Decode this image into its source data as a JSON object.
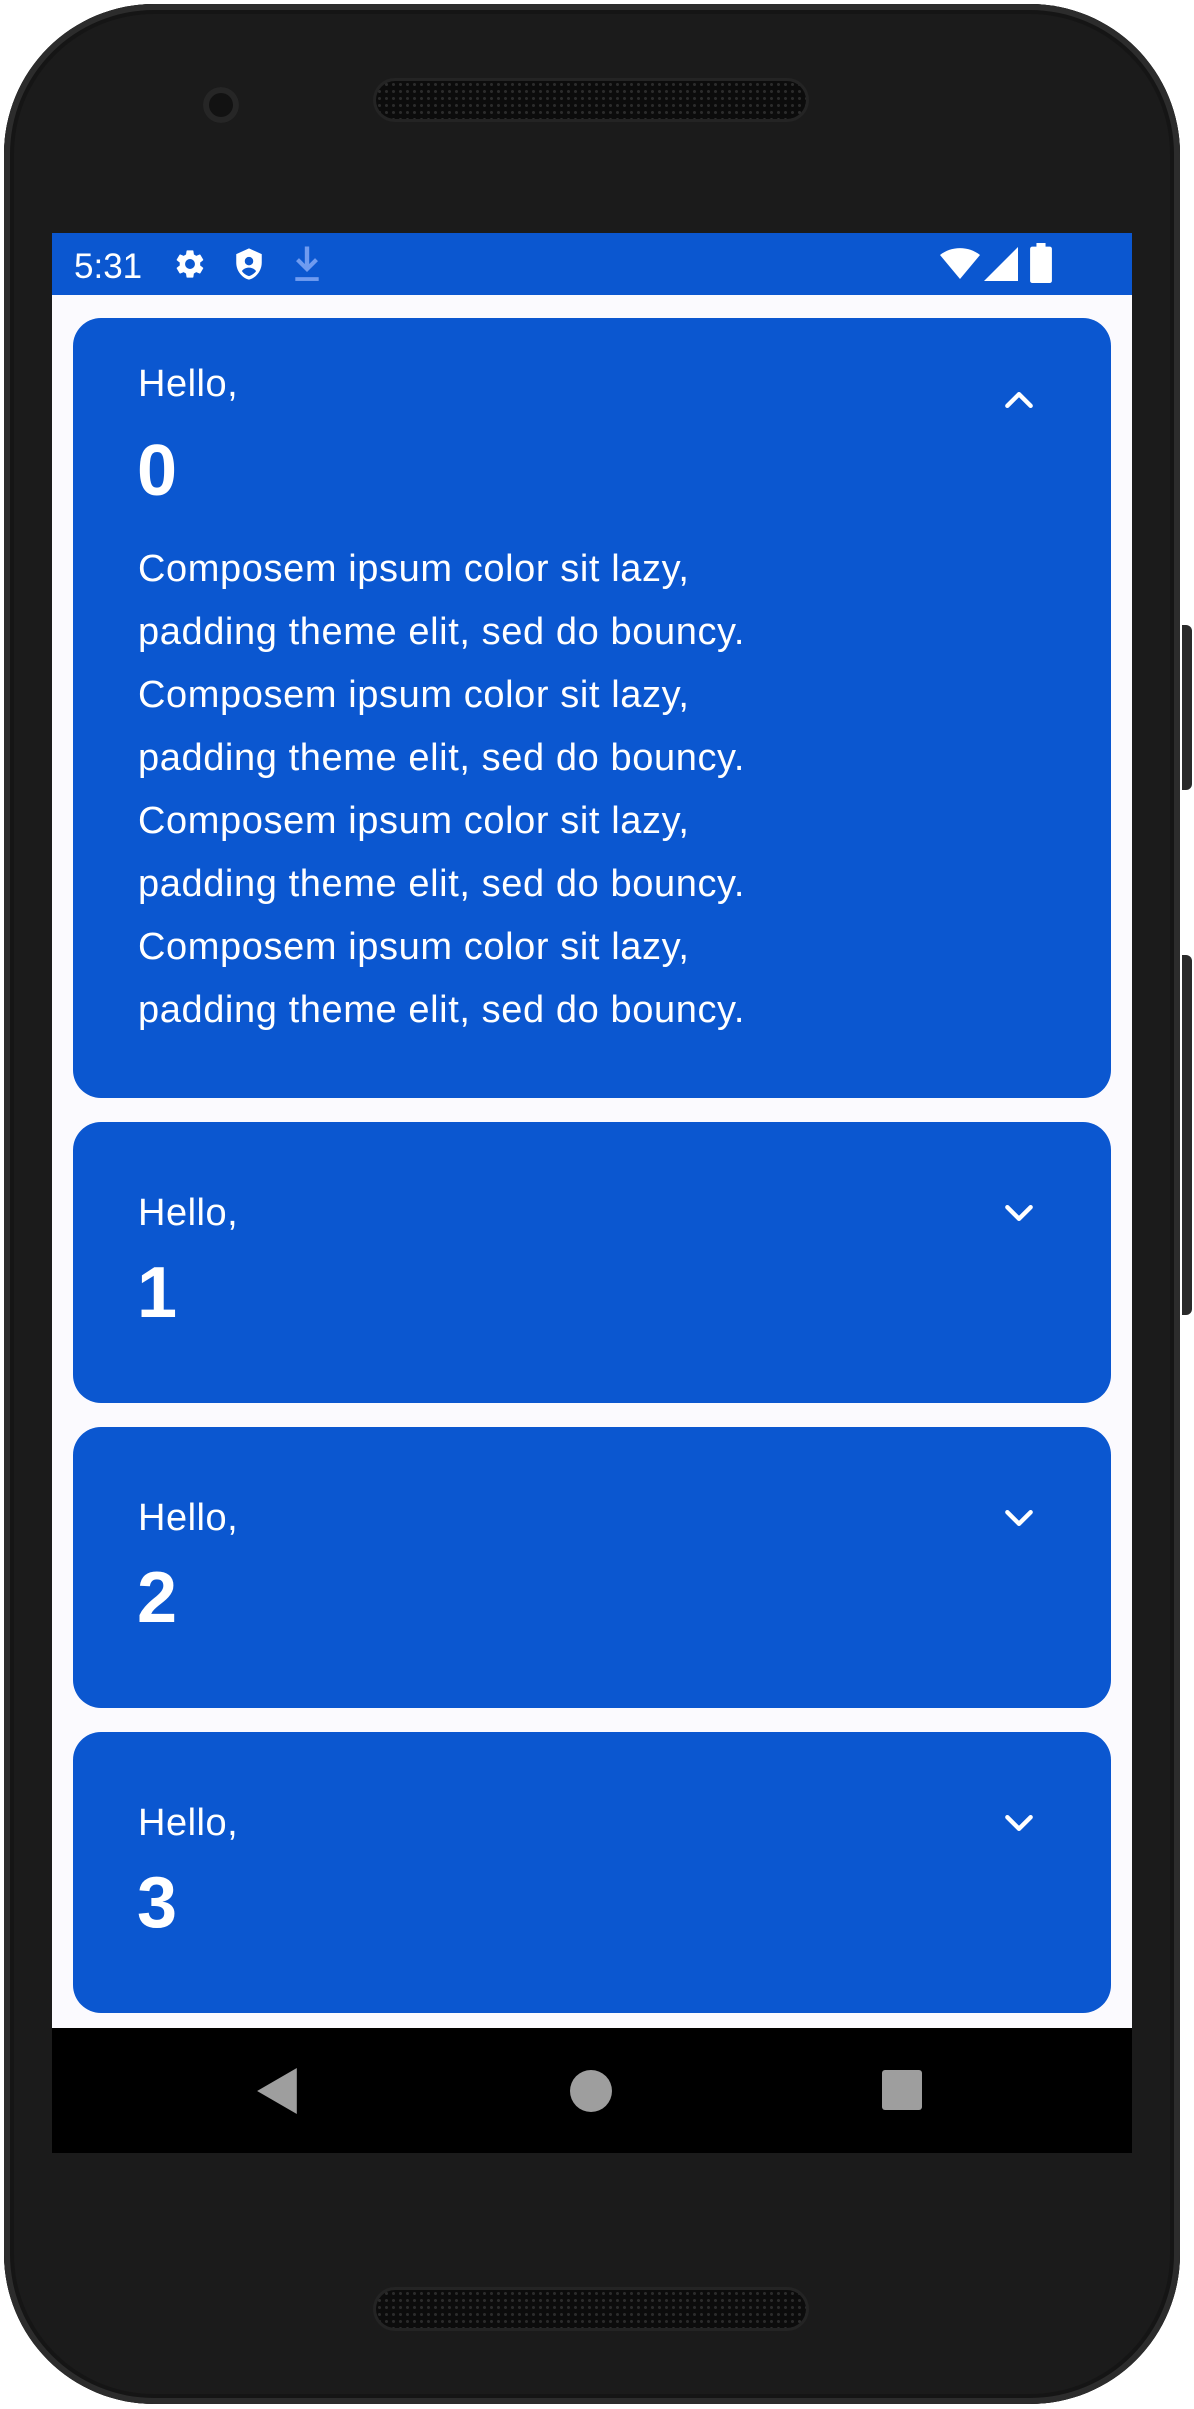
{
  "status_bar": {
    "time": "5:31",
    "left_icons": [
      "settings-icon",
      "shield-icon",
      "download-icon"
    ],
    "right_icons": [
      "wifi-icon",
      "signal-icon",
      "battery-icon"
    ],
    "color": "#0b57d0"
  },
  "cards": [
    {
      "greeting": "Hello,",
      "number": "0",
      "expanded": true,
      "toggle_icon": "chevron-up-icon",
      "body": "Composem ipsum color sit lazy,\npadding theme elit, sed do bouncy.\nComposem ipsum color sit lazy,\npadding theme elit, sed do bouncy.\nComposem ipsum color sit lazy,\npadding theme elit, sed do bouncy.\nComposem ipsum color sit lazy,\npadding theme elit, sed do bouncy."
    },
    {
      "greeting": "Hello,",
      "number": "1",
      "expanded": false,
      "toggle_icon": "chevron-down-icon"
    },
    {
      "greeting": "Hello,",
      "number": "2",
      "expanded": false,
      "toggle_icon": "chevron-down-icon"
    },
    {
      "greeting": "Hello,",
      "number": "3",
      "expanded": false,
      "toggle_icon": "chevron-down-icon"
    }
  ],
  "nav_bar": {
    "buttons": [
      "back-icon",
      "home-icon",
      "recents-icon"
    ]
  },
  "colors": {
    "card_background": "#0b57d0",
    "screen_background": "#fbfafe",
    "text": "#ffffff"
  }
}
